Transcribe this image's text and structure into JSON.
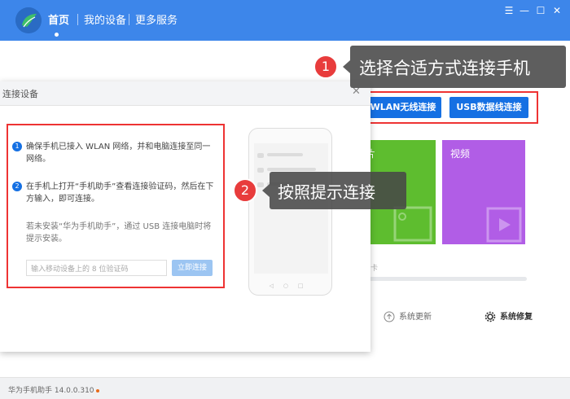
{
  "nav": {
    "items": [
      {
        "label": "首页"
      },
      {
        "label": "我的设备"
      },
      {
        "label": "更多服务"
      }
    ]
  },
  "window_controls": {
    "settings": "☰",
    "minimize": "—",
    "maximize": "☐",
    "close": "✕"
  },
  "buttons": {
    "wlan": "WLAN无线连接",
    "usb": "USB数据线连接"
  },
  "callouts": {
    "one": {
      "num": "1",
      "text": "选择合适方式连接手机"
    },
    "two": {
      "num": "2",
      "text": "按照提示连接"
    }
  },
  "tiles": {
    "photos": "片",
    "videos": "视频"
  },
  "tools": {
    "update": "系统更新",
    "repair": "系统修复"
  },
  "main_hint": "卡",
  "dialog": {
    "title": "连接设备",
    "close": "✕",
    "steps": [
      {
        "num": "1",
        "text": "确保手机已接入 WLAN 网络，并和电脑连接至同一网络。"
      },
      {
        "num": "2",
        "text": "在手机上打开“手机助手”查看连接验证码，然后在下方输入，即可连接。"
      }
    ],
    "note": "若未安装“华为手机助手”，通过 USB 连接电脑时将提示安装。",
    "code_placeholder": "输入移动设备上的 8 位验证码",
    "confirm": "立即连接",
    "phone_nav": "◁○□"
  },
  "footer": {
    "version": "华为手机助手 14.0.0.310"
  },
  "colors": {
    "accent": "#3d86ea",
    "button": "#1570e3",
    "highlight": "#e33333",
    "green_tile": "#5ebd2f",
    "purple_tile": "#b15de6"
  }
}
